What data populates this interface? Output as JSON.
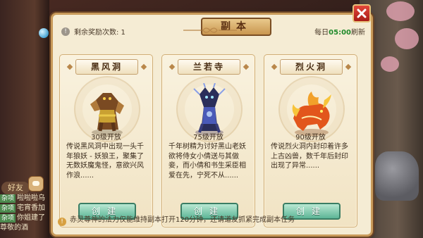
{
  "dialog": {
    "title": "副本",
    "reward_count_label": "剩余奖励次数: 1",
    "refresh_prefix": "每日",
    "refresh_time": "05:00",
    "refresh_suffix": "刷新",
    "bottom_note": "赤灵尊神的法力仅能维持副本打开120分钟，还请道友抓紧完成副本任务"
  },
  "dungeons": [
    {
      "name": "黑风洞",
      "level": "30级开放",
      "description": "传说黑风洞中出现一头千年狼妖 - 妖狼王，聚集了无数妖魔鬼怪，意欲兴风作浪......",
      "button": "创建",
      "monster_icon": "wolf-king-monster-icon",
      "accent": "#8a5a2a"
    },
    {
      "name": "兰若寺",
      "level": "75级开放",
      "description": "千年树精为讨好黑山老妖欲将侍女小倩送与其做妾，而小倩和书生采臣相爱在先，宁死不从......",
      "button": "创建",
      "monster_icon": "tree-demon-monster-icon",
      "accent": "#3a4aa8"
    },
    {
      "name": "烈火洞",
      "level": "90级开放",
      "description": "传说烈火洞内封印着许多上古凶兽，数千年后封印出现了异常......",
      "button": "创建",
      "monster_icon": "fire-beast-monster-icon",
      "accent": "#e2561c"
    }
  ],
  "side": {
    "friend_label": "好友",
    "chat_lines": [
      {
        "tag": "杂项",
        "text": "啦啦啦乌"
      },
      {
        "tag": "杂项",
        "text": "宅宵香加"
      },
      {
        "tag": "杂项",
        "text": "你姐建了"
      },
      {
        "tag": "",
        "text": "尊敬的酒"
      }
    ]
  },
  "colors": {
    "panel_bg": "#f5ecd4",
    "button_green": "#5db596",
    "close_red": "#c62a20",
    "refresh_green": "#1f8a2a"
  }
}
